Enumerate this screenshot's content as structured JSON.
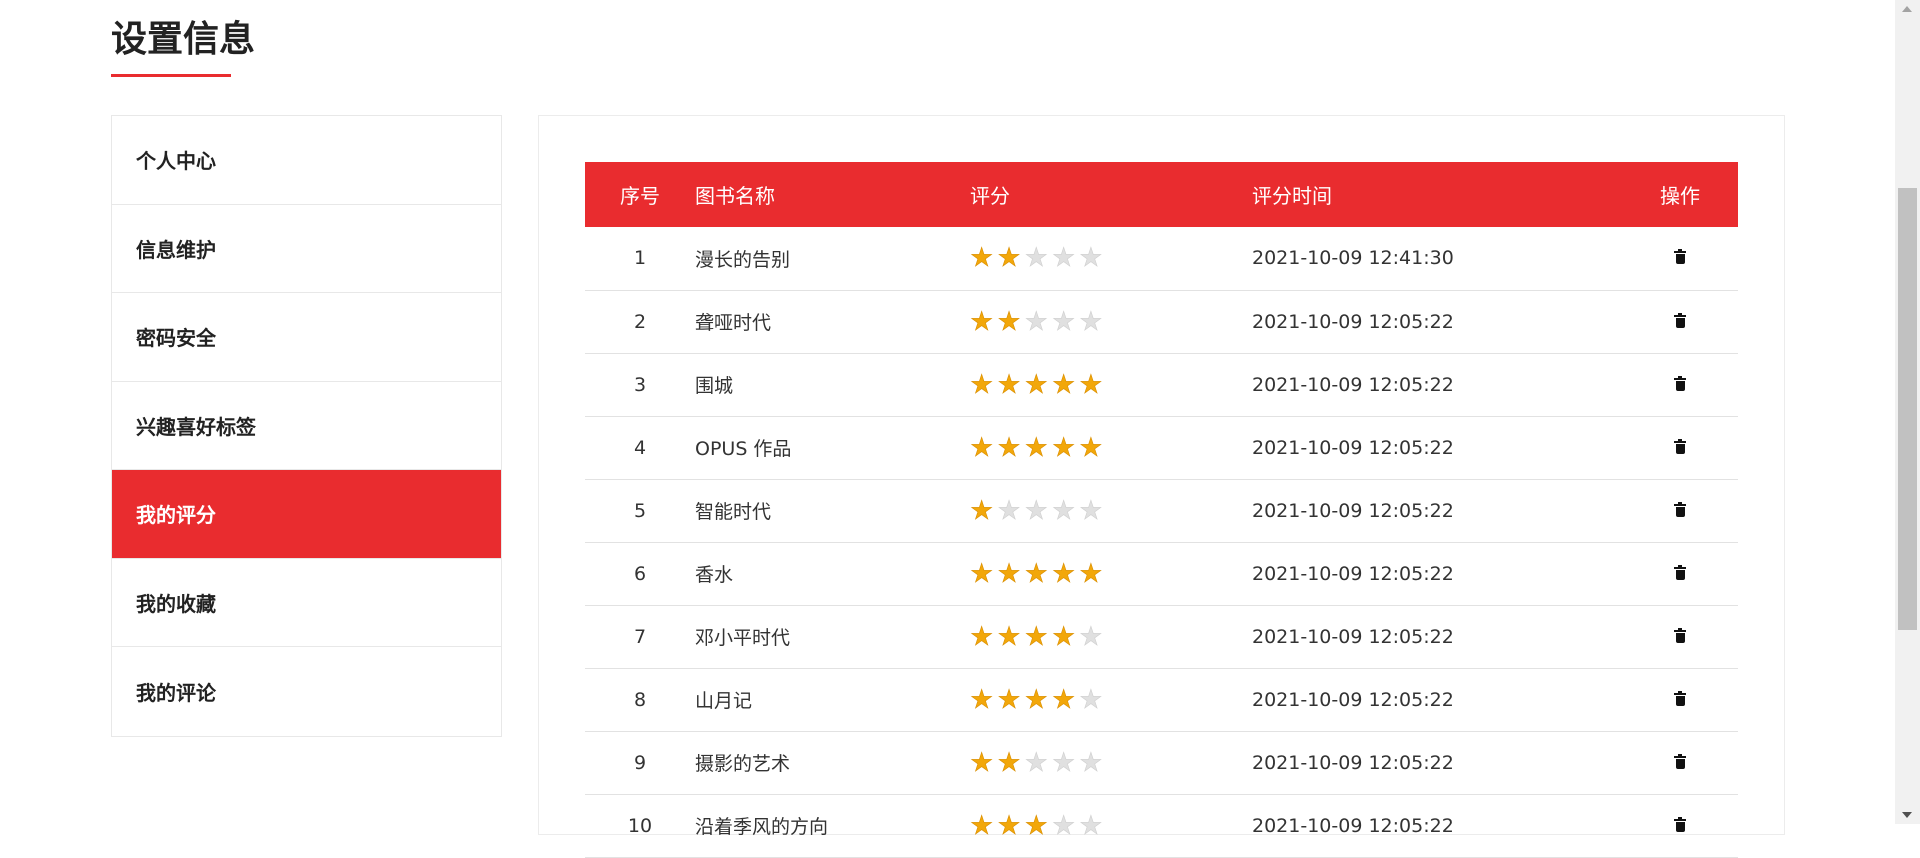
{
  "page_title": "设置信息",
  "sidebar": {
    "items": [
      {
        "label": "个人中心",
        "active": false
      },
      {
        "label": "信息维护",
        "active": false
      },
      {
        "label": "密码安全",
        "active": false
      },
      {
        "label": "兴趣喜好标签",
        "active": false
      },
      {
        "label": "我的评分",
        "active": true
      },
      {
        "label": "我的收藏",
        "active": false
      },
      {
        "label": "我的评论",
        "active": false
      }
    ]
  },
  "table": {
    "headers": [
      "序号",
      "图书名称",
      "评分",
      "评分时间",
      "操作"
    ],
    "max_rating": 5,
    "delete_icon": "trash-icon",
    "rows": [
      {
        "index": "1",
        "name": "漫长的告别",
        "rating": 2,
        "time": "2021-10-09 12:41:30"
      },
      {
        "index": "2",
        "name": "聋哑时代",
        "rating": 2,
        "time": "2021-10-09 12:05:22"
      },
      {
        "index": "3",
        "name": "围城",
        "rating": 5,
        "time": "2021-10-09 12:05:22"
      },
      {
        "index": "4",
        "name": "OPUS 作品",
        "rating": 5,
        "time": "2021-10-09 12:05:22"
      },
      {
        "index": "5",
        "name": "智能时代",
        "rating": 1,
        "time": "2021-10-09 12:05:22"
      },
      {
        "index": "6",
        "name": "香水",
        "rating": 5,
        "time": "2021-10-09 12:05:22"
      },
      {
        "index": "7",
        "name": "邓小平时代",
        "rating": 4,
        "time": "2021-10-09 12:05:22"
      },
      {
        "index": "8",
        "name": "山月记",
        "rating": 4,
        "time": "2021-10-09 12:05:22"
      },
      {
        "index": "9",
        "name": "摄影的艺术",
        "rating": 2,
        "time": "2021-10-09 12:05:22"
      },
      {
        "index": "10",
        "name": "沿着季风的方向",
        "rating": 3,
        "time": "2021-10-09 12:05:22"
      }
    ]
  },
  "colors": {
    "accent": "#e92c2f",
    "star_on": "#f2a70a",
    "star_off": "#e0e0e0"
  }
}
